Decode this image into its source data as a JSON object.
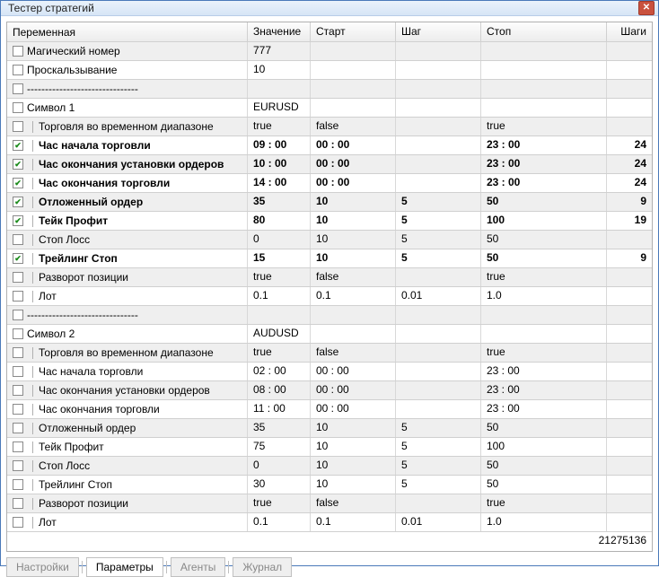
{
  "window": {
    "title": "Тестер стратегий"
  },
  "columns": {
    "var": "Переменная",
    "val": "Значение",
    "start": "Старт",
    "step": "Шаг",
    "stop": "Стоп",
    "steps": "Шаги"
  },
  "rows": [
    {
      "checked": false,
      "hasSep": false,
      "bold": false,
      "indent": 0,
      "name": "Магический номер",
      "val": "777",
      "start": "",
      "step": "",
      "stop": "",
      "steps": "",
      "alt": true
    },
    {
      "checked": false,
      "hasSep": false,
      "bold": false,
      "indent": 0,
      "name": "Проскальзывание",
      "val": "10",
      "start": "",
      "step": "",
      "stop": "",
      "steps": "",
      "alt": false
    },
    {
      "checked": false,
      "hasSep": false,
      "bold": false,
      "indent": 0,
      "name": "-------------------------------",
      "val": "",
      "start": "",
      "step": "",
      "stop": "",
      "steps": "",
      "alt": true
    },
    {
      "checked": false,
      "hasSep": false,
      "bold": false,
      "indent": 0,
      "name": "Символ 1",
      "val": "EURUSD",
      "start": "",
      "step": "",
      "stop": "",
      "steps": "",
      "alt": false
    },
    {
      "checked": false,
      "hasSep": true,
      "bold": false,
      "indent": 1,
      "name": "Торговля во временном диапазоне",
      "val": "true",
      "start": "false",
      "step": "",
      "stop": "true",
      "steps": "",
      "alt": true
    },
    {
      "checked": true,
      "hasSep": true,
      "bold": true,
      "indent": 1,
      "name": "Час начала торговли",
      "val": "09 : 00",
      "start": "00 : 00",
      "step": "",
      "stop": "23 : 00",
      "steps": "24",
      "alt": false
    },
    {
      "checked": true,
      "hasSep": true,
      "bold": true,
      "indent": 1,
      "name": "Час окончания установки ордеров",
      "val": "10 : 00",
      "start": "00 : 00",
      "step": "",
      "stop": "23 : 00",
      "steps": "24",
      "alt": true
    },
    {
      "checked": true,
      "hasSep": true,
      "bold": true,
      "indent": 1,
      "name": "Час окончания торговли",
      "val": "14 : 00",
      "start": "00 : 00",
      "step": "",
      "stop": "23 : 00",
      "steps": "24",
      "alt": false
    },
    {
      "checked": true,
      "hasSep": true,
      "bold": true,
      "indent": 1,
      "name": "Отложенный ордер",
      "val": "35",
      "start": "10",
      "step": "5",
      "stop": "50",
      "steps": "9",
      "alt": true
    },
    {
      "checked": true,
      "hasSep": true,
      "bold": true,
      "indent": 1,
      "name": "Тейк Профит",
      "val": "80",
      "start": "10",
      "step": "5",
      "stop": "100",
      "steps": "19",
      "alt": false
    },
    {
      "checked": false,
      "hasSep": true,
      "bold": false,
      "indent": 1,
      "name": "Стоп Лосс",
      "val": "0",
      "start": "10",
      "step": "5",
      "stop": "50",
      "steps": "",
      "alt": true
    },
    {
      "checked": true,
      "hasSep": true,
      "bold": true,
      "indent": 1,
      "name": "Трейлинг Стоп",
      "val": "15",
      "start": "10",
      "step": "5",
      "stop": "50",
      "steps": "9",
      "alt": false
    },
    {
      "checked": false,
      "hasSep": true,
      "bold": false,
      "indent": 1,
      "name": "Разворот позиции",
      "val": "true",
      "start": "false",
      "step": "",
      "stop": "true",
      "steps": "",
      "alt": true
    },
    {
      "checked": false,
      "hasSep": true,
      "bold": false,
      "indent": 1,
      "name": "Лот",
      "val": "0.1",
      "start": "0.1",
      "step": "0.01",
      "stop": "1.0",
      "steps": "",
      "alt": false
    },
    {
      "checked": false,
      "hasSep": false,
      "bold": false,
      "indent": 0,
      "name": "-------------------------------",
      "val": "",
      "start": "",
      "step": "",
      "stop": "",
      "steps": "",
      "alt": true
    },
    {
      "checked": false,
      "hasSep": false,
      "bold": false,
      "indent": 0,
      "name": "Символ 2",
      "val": "AUDUSD",
      "start": "",
      "step": "",
      "stop": "",
      "steps": "",
      "alt": false
    },
    {
      "checked": false,
      "hasSep": true,
      "bold": false,
      "indent": 1,
      "name": "Торговля во временном диапазоне",
      "val": "true",
      "start": "false",
      "step": "",
      "stop": "true",
      "steps": "",
      "alt": true
    },
    {
      "checked": false,
      "hasSep": true,
      "bold": false,
      "indent": 1,
      "name": "Час начала торговли",
      "val": "02 : 00",
      "start": "00 : 00",
      "step": "",
      "stop": "23 : 00",
      "steps": "",
      "alt": false
    },
    {
      "checked": false,
      "hasSep": true,
      "bold": false,
      "indent": 1,
      "name": "Час окончания установки ордеров",
      "val": "08 : 00",
      "start": "00 : 00",
      "step": "",
      "stop": "23 : 00",
      "steps": "",
      "alt": true
    },
    {
      "checked": false,
      "hasSep": true,
      "bold": false,
      "indent": 1,
      "name": "Час окончания торговли",
      "val": "11 : 00",
      "start": "00 : 00",
      "step": "",
      "stop": "23 : 00",
      "steps": "",
      "alt": false
    },
    {
      "checked": false,
      "hasSep": true,
      "bold": false,
      "indent": 1,
      "name": "Отложенный ордер",
      "val": "35",
      "start": "10",
      "step": "5",
      "stop": "50",
      "steps": "",
      "alt": true
    },
    {
      "checked": false,
      "hasSep": true,
      "bold": false,
      "indent": 1,
      "name": "Тейк Профит",
      "val": "75",
      "start": "10",
      "step": "5",
      "stop": "100",
      "steps": "",
      "alt": false
    },
    {
      "checked": false,
      "hasSep": true,
      "bold": false,
      "indent": 1,
      "name": "Стоп Лосс",
      "val": "0",
      "start": "10",
      "step": "5",
      "stop": "50",
      "steps": "",
      "alt": true
    },
    {
      "checked": false,
      "hasSep": true,
      "bold": false,
      "indent": 1,
      "name": "Трейлинг Стоп",
      "val": "30",
      "start": "10",
      "step": "5",
      "stop": "50",
      "steps": "",
      "alt": false
    },
    {
      "checked": false,
      "hasSep": true,
      "bold": false,
      "indent": 1,
      "name": "Разворот позиции",
      "val": "true",
      "start": "false",
      "step": "",
      "stop": "true",
      "steps": "",
      "alt": true
    },
    {
      "checked": false,
      "hasSep": true,
      "bold": false,
      "indent": 1,
      "name": "Лот",
      "val": "0.1",
      "start": "0.1",
      "step": "0.01",
      "stop": "1.0",
      "steps": "",
      "alt": false
    }
  ],
  "footer": {
    "total": "21275136"
  },
  "tabs": [
    {
      "label": "Настройки",
      "active": false
    },
    {
      "label": "Параметры",
      "active": true
    },
    {
      "label": "Агенты",
      "active": false
    },
    {
      "label": "Журнал",
      "active": false
    }
  ]
}
